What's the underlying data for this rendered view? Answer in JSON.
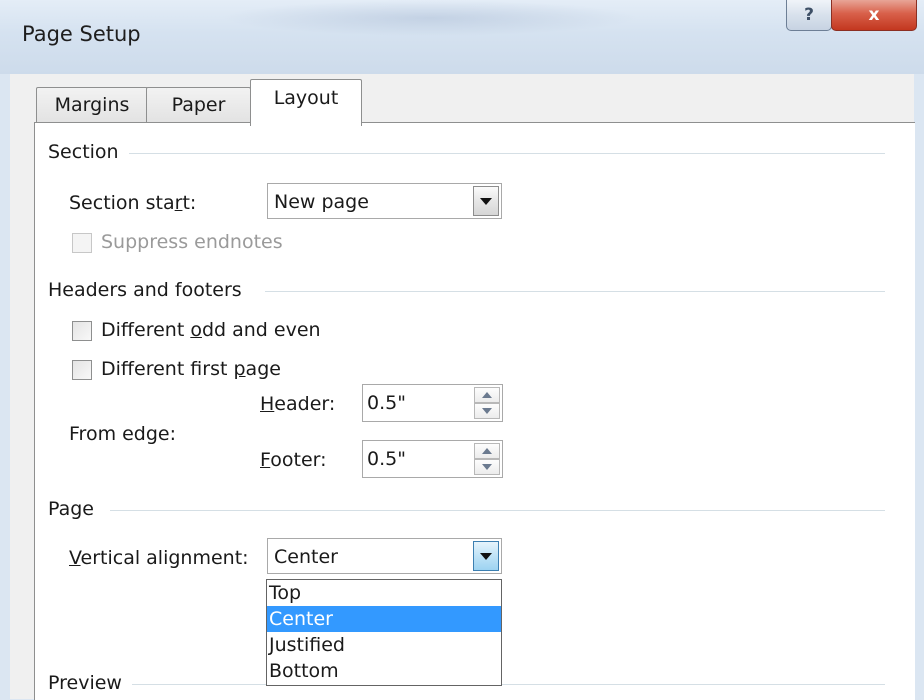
{
  "window": {
    "title": "Page Setup",
    "help_label": "?",
    "close_label": "x"
  },
  "tabs": [
    {
      "label": "Margins"
    },
    {
      "label": "Paper"
    },
    {
      "label": "Layout",
      "active": true
    }
  ],
  "section": {
    "group_label": "Section",
    "start_label_pre": "Section sta",
    "start_label_u": "r",
    "start_label_post": "t:",
    "start_value": "New page",
    "suppress_endnotes_label": "Suppress endnotes"
  },
  "headers_footers": {
    "group_label": "Headers and footers",
    "odd_even_pre": "Different ",
    "odd_even_u": "o",
    "odd_even_post": "dd and even",
    "first_page_pre": "Different first ",
    "first_page_u": "p",
    "first_page_post": "age",
    "from_edge_label": "From edge:",
    "header_label_u": "H",
    "header_label_post": "eader:",
    "header_value": "0.5\"",
    "footer_label_u": "F",
    "footer_label_post": "ooter:",
    "footer_value": "0.5\""
  },
  "page": {
    "group_label": "Page",
    "vertical_alignment_u": "V",
    "vertical_alignment_post": "ertical alignment:",
    "vertical_alignment_value": "Center",
    "options": [
      "Top",
      "Center",
      "Justified",
      "Bottom"
    ],
    "selected_option": "Center"
  },
  "preview": {
    "group_label": "Preview"
  },
  "colors": {
    "selection": "#3399ff",
    "close_button": "#c3371f"
  }
}
